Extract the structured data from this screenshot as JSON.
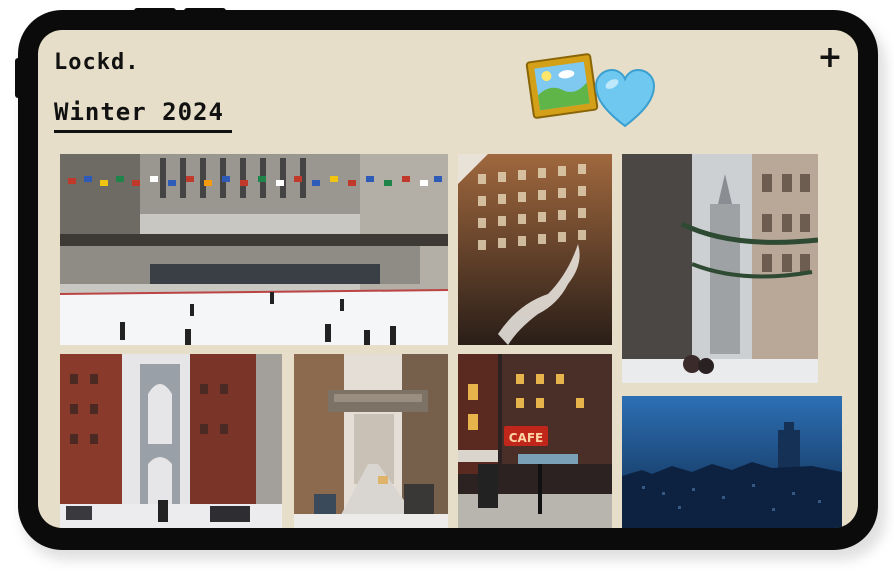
{
  "app": {
    "brand": "Lockd."
  },
  "album": {
    "title": "Winter 2024"
  },
  "toolbar": {
    "add_label": "+"
  },
  "stickers": [
    "framed-picture-icon",
    "light-blue-heart-icon"
  ],
  "photos": [
    {
      "id": "rink"
    },
    {
      "id": "steam-building"
    },
    {
      "id": "snowy-street-garland"
    },
    {
      "id": "bridge-snow"
    },
    {
      "id": "skybridge-street"
    },
    {
      "id": "cafe-night",
      "sign": "CAFE"
    },
    {
      "id": "blue-skyline"
    }
  ],
  "colors": {
    "paper": "#e6dec8",
    "device": "#0b0b0b",
    "accent_heart": "#6ec8f0"
  }
}
